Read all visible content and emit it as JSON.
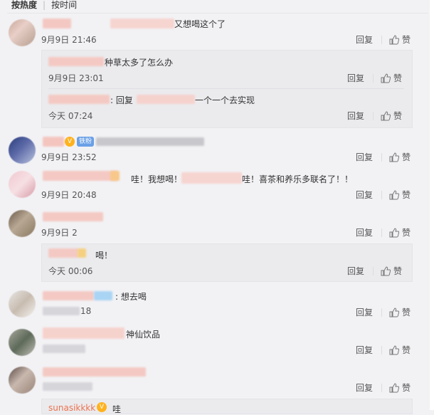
{
  "sort": {
    "hot_label": "按热度",
    "time_label": "按时间"
  },
  "actions": {
    "reply": "回复",
    "like": "赞"
  },
  "comments": [
    {
      "text": "又想喝这个了",
      "time": "9月9日 21:46"
    },
    {
      "text": "种草太多了怎么办",
      "time": "9月9日 23:01"
    },
    {
      "prefix": ": 回复",
      "text": "一个一个去实现",
      "time": "今天 07:24"
    },
    {
      "badge": "铁粉",
      "time": "9月9日 23:52"
    },
    {
      "text_a": "哇！我想喝！",
      "text_b": "哇！喜茶和养乐多联名了！！",
      "time": "9月9日 20:48"
    },
    {
      "time": "9月9日 2"
    },
    {
      "text": "喝！",
      "time": "今天 00:06"
    },
    {
      "text": ": 想去喝",
      "time": "18"
    },
    {
      "text": "神仙饮品"
    },
    {},
    {
      "user": "sunasikkkk",
      "text": "哇"
    }
  ]
}
